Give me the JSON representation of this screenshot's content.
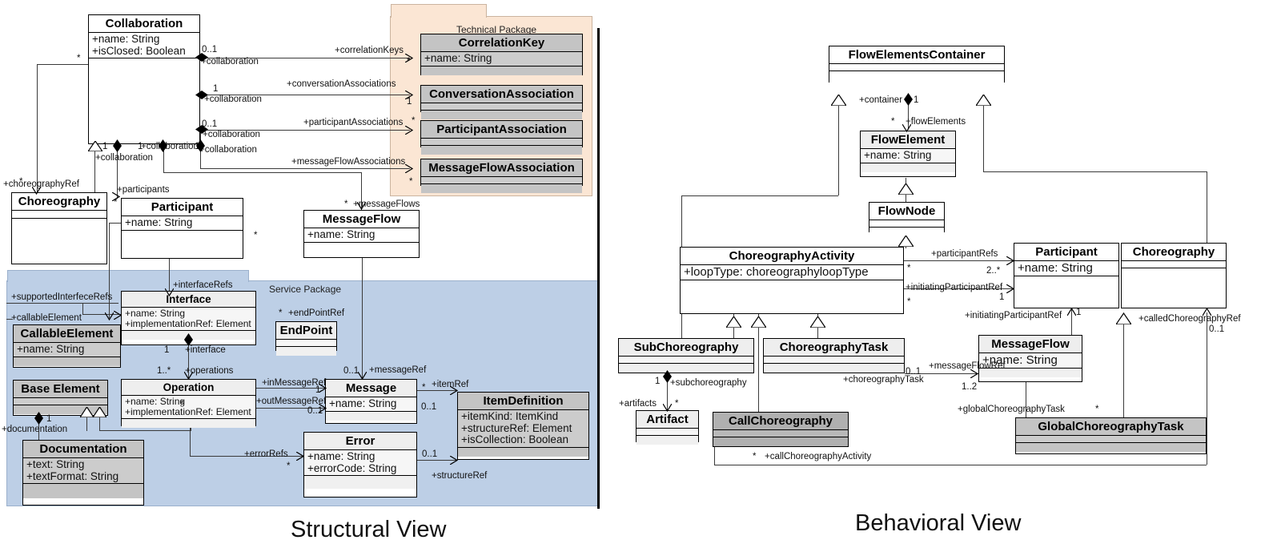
{
  "figure": {
    "captions": {
      "structural": "Structural View",
      "behavioral": "Behavioral View"
    },
    "packages": {
      "technical": "Technical Package",
      "service": "Service Package"
    },
    "colors": {
      "technical_package_bg": "#fbe6d4",
      "service_package_bg": "#bdcfe6",
      "gray_class_fill": "#c4c4c4",
      "dark_gray_class_fill": "#b0b0b0",
      "light_class_fill": "#eeeeee",
      "white_class_fill": "#ffffff",
      "line": "#3a3a3a"
    }
  },
  "structural_view": {
    "classes": [
      {
        "id": "collaboration",
        "name": "Collaboration",
        "attributes": [
          "+name: String",
          "+isClosed: Boolean"
        ],
        "fill": "white"
      },
      {
        "id": "choreography",
        "name": "Choreography",
        "attributes": [],
        "fill": "white"
      },
      {
        "id": "participant",
        "name": "Participant",
        "attributes": [
          "+name: String"
        ],
        "fill": "white"
      },
      {
        "id": "messageflow",
        "name": "MessageFlow",
        "attributes": [
          "+name: String"
        ],
        "fill": "white"
      },
      {
        "id": "correlationkey",
        "name": "CorrelationKey",
        "attributes": [
          "+name: String"
        ],
        "fill": "gray"
      },
      {
        "id": "conversationassociation",
        "name": "ConversationAssociation",
        "attributes": [],
        "fill": "gray"
      },
      {
        "id": "participantassociation",
        "name": "ParticipantAssociation",
        "attributes": [],
        "fill": "gray"
      },
      {
        "id": "messageflowassociation",
        "name": "MessageFlowAssociation",
        "attributes": [],
        "fill": "gray"
      },
      {
        "id": "interface",
        "name": "Interface",
        "attributes": [
          "+name: String",
          "+implementationRef: Element"
        ],
        "fill": "lite"
      },
      {
        "id": "callableelement",
        "name": "CallableElement",
        "attributes": [
          "+name: String"
        ],
        "fill": "gray"
      },
      {
        "id": "baseelement",
        "name": "Base Element",
        "attributes": [],
        "fill": "gray"
      },
      {
        "id": "documentation",
        "name": "Documentation",
        "attributes": [
          "+text: String",
          "+textFormat: String"
        ],
        "fill": "gray"
      },
      {
        "id": "endpoint",
        "name": "EndPoint",
        "attributes": [],
        "fill": "lite"
      },
      {
        "id": "operation",
        "name": "Operation",
        "attributes": [
          "+name: String",
          "+implementationRef: Element"
        ],
        "fill": "lite"
      },
      {
        "id": "message",
        "name": "Message",
        "attributes": [
          "+name: String"
        ],
        "fill": "lite"
      },
      {
        "id": "error",
        "name": "Error",
        "attributes": [
          "+name: String",
          "+errorCode: String"
        ],
        "fill": "lite"
      },
      {
        "id": "itemdefinition",
        "name": "ItemDefinition",
        "attributes": [
          "+itemKind: ItemKind",
          "+structureRef: Element",
          "+isCollection: Boolean"
        ],
        "fill": "gray"
      }
    ],
    "role_labels": [
      "+collaboration",
      "+collaboration",
      "+collaboration",
      "+collaboration",
      "+collaboration",
      "+collaboration",
      "+correlationKeys",
      "+conversationAssociations",
      "+participantAssociations",
      "+messageFlowAssociations",
      "+choreographyRef",
      "+participants",
      "+messageFlows",
      "+supportedInterfeceRefs",
      "+callableElement",
      "+interfaceRefs",
      "+interface",
      "+operations",
      "+endPointRef",
      "+inMessageRef",
      "+outMessageRef",
      "+messageRef",
      "+itemRef",
      "+errorRefs",
      "+structureRef",
      "+documentation"
    ],
    "multiplicities": [
      "*",
      "0..1",
      "1",
      "0..1",
      "1",
      "1",
      "1",
      "*",
      "1",
      "*",
      "*",
      "*",
      "*",
      "*",
      "*",
      "1",
      "1..*",
      "*",
      "0..1",
      "1",
      "0..1",
      "*",
      "0..1",
      "*",
      "*",
      "0..1",
      "1"
    ]
  },
  "behavioral_view": {
    "classes": [
      {
        "id": "flowelementscontainer",
        "name": "FlowElementsContainer",
        "attributes": [],
        "fill": "white"
      },
      {
        "id": "flowelement",
        "name": "FlowElement",
        "attributes": [
          "+name: String"
        ],
        "fill": "lite"
      },
      {
        "id": "flownode",
        "name": "FlowNode",
        "attributes": [],
        "fill": "white"
      },
      {
        "id": "choreographyactivity",
        "name": "ChoreographyActivity",
        "attributes": [
          "+loopType: choreographyloopType"
        ],
        "fill": "white"
      },
      {
        "id": "participant",
        "name": "Participant",
        "attributes": [
          "+name: String"
        ],
        "fill": "white"
      },
      {
        "id": "choreography",
        "name": "Choreography",
        "attributes": [],
        "fill": "white"
      },
      {
        "id": "subchoreography",
        "name": "SubChoreography",
        "attributes": [],
        "fill": "lite"
      },
      {
        "id": "choreographytask",
        "name": "ChoreographyTask",
        "attributes": [],
        "fill": "lite"
      },
      {
        "id": "messageflow",
        "name": "MessageFlow",
        "attributes": [
          "+name: String"
        ],
        "fill": "lite"
      },
      {
        "id": "artifact",
        "name": "Artifact",
        "attributes": [],
        "fill": "lite"
      },
      {
        "id": "callchoreography",
        "name": "CallChoreography",
        "attributes": [],
        "fill": "dgray"
      },
      {
        "id": "globalchoreographytask",
        "name": "GlobalChoreographyTask",
        "attributes": [],
        "fill": "gray"
      }
    ],
    "role_labels": [
      "+container",
      "+flowElements",
      "+participantRefs",
      "+initiatingParticipantRef",
      "+initiatingParticipantRef",
      "+calledChoreographyRef",
      "+subchoreography",
      "+artifacts",
      "+messageFlowRef",
      "+choreographyTask",
      "+globalChoreographyTask",
      "+callChoreographyActivity"
    ],
    "multiplicities": [
      "1",
      "*",
      "*",
      "2..*",
      "*",
      "1",
      "1",
      "0..1",
      "1",
      "*",
      "0..1",
      "1..2",
      "*",
      "*"
    ]
  }
}
